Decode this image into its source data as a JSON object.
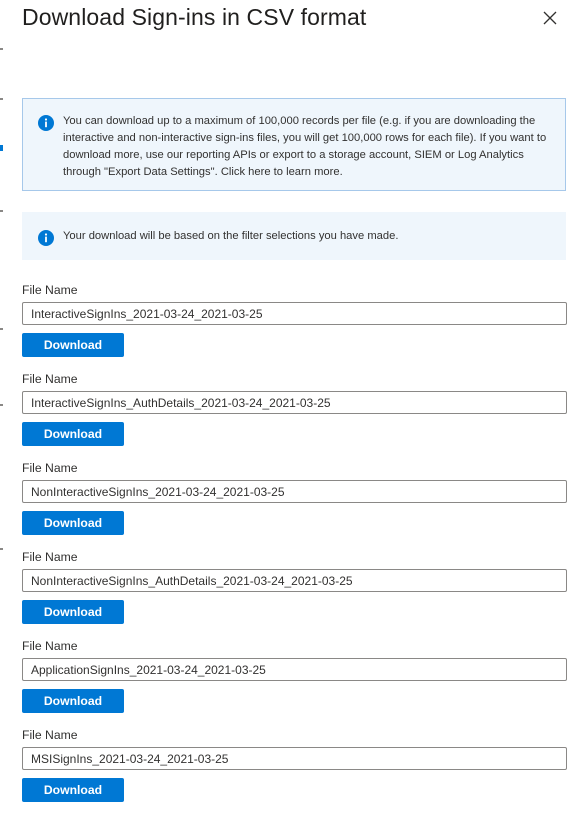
{
  "panel": {
    "title": "Download Sign-ins in CSV format",
    "close_icon": "close-icon"
  },
  "info": {
    "primary_text": "You can download up to a maximum of 100,000 records per file (e.g. if you are downloading the interactive and non-interactive sign-ins files, you will get 100,000 rows for each file).  If you want to download more, use our reporting APIs or export to a storage account, SIEM or Log Analytics through \"Export Data Settings\". Click here to learn more.",
    "secondary_text": "Your download will be based on the filter selections you have made.",
    "icon": "info-icon",
    "icon_color": "#0078d4"
  },
  "files": [
    {
      "label": "File Name",
      "value": "InteractiveSignIns_2021-03-24_2021-03-25",
      "button": "Download"
    },
    {
      "label": "File Name",
      "value": "InteractiveSignIns_AuthDetails_2021-03-24_2021-03-25",
      "button": "Download"
    },
    {
      "label": "File Name",
      "value": "NonInteractiveSignIns_2021-03-24_2021-03-25",
      "button": "Download"
    },
    {
      "label": "File Name",
      "value": "NonInteractiveSignIns_AuthDetails_2021-03-24_2021-03-25",
      "button": "Download"
    },
    {
      "label": "File Name",
      "value": "ApplicationSignIns_2021-03-24_2021-03-25",
      "button": "Download"
    },
    {
      "label": "File Name",
      "value": "MSISignIns_2021-03-24_2021-03-25",
      "button": "Download"
    }
  ],
  "colors": {
    "accent": "#0078d4",
    "info_background": "#eff6fc",
    "info_border": "#a6c8ea"
  }
}
